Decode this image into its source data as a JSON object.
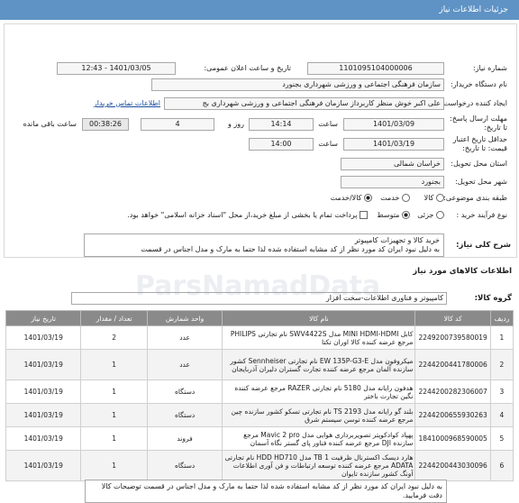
{
  "header": {
    "title": "جزئیات اطلاعات نیاز"
  },
  "fields": {
    "need_number_label": "شماره نیاز:",
    "need_number": "1101095104000006",
    "announce_label": "تاریخ و ساعت اعلان عمومی:",
    "announce_value": "1401/03/05 - 12:43",
    "buyer_label": "نام دستگاه خریدار:",
    "buyer_value": "سازمان فرهنگی اجتماعی و ورزشی شهرداری بجنورد",
    "creator_label": "ایجاد کننده درخواست:",
    "creator_value": "علی اکبر خوش منظر کاربرداز سازمان فرهنگی اجتماعی و ورزشی شهرداری بج",
    "contact_link": "اطلاعات تماس خریدار",
    "deadline_label": "مهلت ارسال پاسخ: تا تاریخ:",
    "deadline_date": "1401/03/09",
    "time_label": "ساعت",
    "deadline_time": "14:14",
    "days_value": "4",
    "days_label": "روز و",
    "timer_value": "00:38:26",
    "remaining_label": "ساعت باقی مانده",
    "validity_label": "حداقل تاریخ اعتبار قیمت: تا تاریخ:",
    "validity_date": "1401/03/19",
    "validity_time": "14:00",
    "province_label": "استان محل تحویل:",
    "province_value": "خراسان شمالی",
    "city_label": "شهر محل تحویل:",
    "city_value": "بجنورد",
    "category_label": "طبقه بندی موضوعی:",
    "cat_goods": "کالا",
    "cat_service": "خدمت",
    "cat_both": "کالا/خدمت",
    "purchase_label": "نوع فرآیند خرید :",
    "purchase_partial": "جزئی",
    "purchase_medium": "متوسط",
    "payment_note": "پرداخت تمام یا بخشی از مبلغ خرید،از محل \"اسناد خزانه اسلامی\" خواهد بود."
  },
  "general_desc": {
    "label": "شرح کلی نیاز:",
    "line1": "خرید کالا و تجهیزات کامپیوتر",
    "line2": "به دلیل نبود ایران کد مورد نظر از کد مشابه استفاده شده لذا حتما به مارک و مدل اجناس در قسمت"
  },
  "goods": {
    "section_title": "اطلاعات کالاهای مورد نیاز",
    "group_label": "گروه کالا:",
    "group_value": "کامپیوتر و فناوری اطلاعات-سخت افزار",
    "columns": [
      "ردیف",
      "کد کالا",
      "نام کالا",
      "واحد شمارش",
      "تعداد / مقدار",
      "تاریخ نیاز"
    ],
    "rows": [
      {
        "n": "1",
        "code": "2249200739580019",
        "name": "کابل MINI HDMI-HDMI مدل SWV4422S نام تجارتی PHILIPS مرجع عرضه کننده کالا اوران تکتا",
        "unit": "عدد",
        "qty": "2",
        "date": "1401/03/19"
      },
      {
        "n": "2",
        "code": "2244200441780006",
        "name": "میکروفون مدل EW 135P-G3-E نام تجارتی Sennheiser کشور سازنده آلمان مرجع عرضه کننده تجارت گستران دلیران آذربایجان",
        "unit": "عدد",
        "qty": "1",
        "date": "1401/03/19"
      },
      {
        "n": "3",
        "code": "2244200282306007",
        "name": "هدفون رایانه مدل 5180 نام تجارتی RAZER مرجع عرضه کننده نگین تجارت باختر",
        "unit": "دستگاه",
        "qty": "1",
        "date": "1401/03/19"
      },
      {
        "n": "4",
        "code": "2244200655930263",
        "name": "بلند گو رایانه مدل 2193 TS نام تجارتی تسکو کشور سازنده چین مرجع عرضه کننده توسن سیستم شرق",
        "unit": "دستگاه",
        "qty": "1",
        "date": "1401/03/19"
      },
      {
        "n": "5",
        "code": "1841000968590005",
        "name": "پهپاد کوادکوپتر تصویربرداری هوایی مدل Mavic 2 pro مرجع سازنده DJI مرجع عرضه کننده فناور پای گستر نگاه آسمان",
        "unit": "فروند",
        "qty": "1",
        "date": "1401/03/19"
      },
      {
        "n": "6",
        "code": "2244200443030096",
        "name": "هارد دیسک اکسترنال ظرفیت 1 TB مدل HDD HD710 نام تجارتی ADATA مرجع عرضه کننده توسعه ارتباطات و فن آوری اطلاعات آونگ کشور سازنده تایوان",
        "unit": "دستگاه",
        "qty": "1",
        "date": "1401/03/19"
      }
    ]
  },
  "buyer_notes": {
    "text": "به دلیل نبود ایران کد مورد نظر از کد مشابه استفاده شده لذا حتما به مارک و مدل اجناس در قسمت توضیحات کالا دقت فرمایید."
  },
  "watermark": "ParsNamadData",
  "colors": {
    "header_bg": "#5f93c5",
    "table_head": "#8a8a8a",
    "link": "#1a4d9e"
  }
}
